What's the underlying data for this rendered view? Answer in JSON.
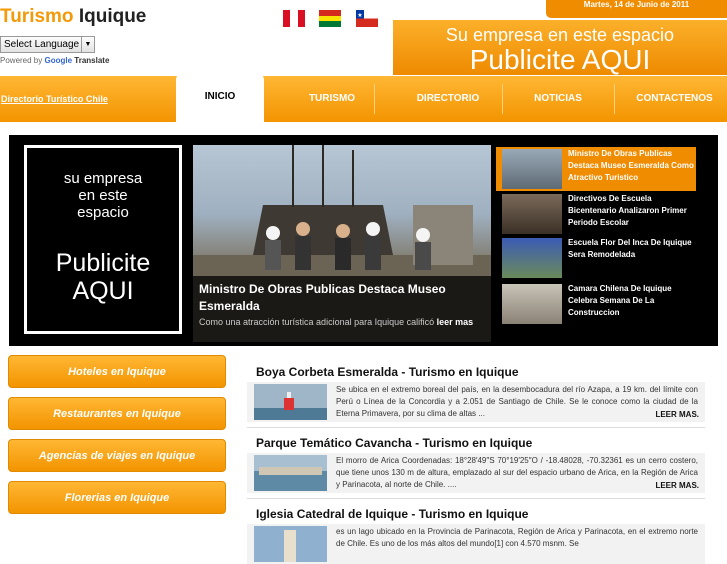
{
  "header": {
    "logo_part1": "Turismo",
    "logo_part2": "Iquique",
    "date": "Martes, 14 de Junio de 2011",
    "translate_select": "Select Language",
    "powered_by": "Powered by",
    "google": "Google",
    "translate": "Translate",
    "banner_line1": "Su empresa en este espacio",
    "banner_line2": "Publicite AQUI"
  },
  "nav": {
    "directory_link": "Directorio Turístico Chile",
    "items": [
      "INICIO",
      "TURISMO",
      "DIRECTORIO",
      "NOTICIAS",
      "CONTACTENOS"
    ]
  },
  "ad": {
    "line1": "su empresa",
    "line2": "en este",
    "line3": "espacio",
    "big1": "Publicite",
    "big2": "AQUI"
  },
  "feature": {
    "title": "Ministro De Obras Publicas Destaca Museo Esmeralda",
    "teaser": "Como una atracción turística adicional para Iquique calificó",
    "more": "leer mas"
  },
  "news": [
    "Ministro De Obras Publicas Destaca Museo Esmeralda Como Atractivo Turistico",
    "Directivos De Escuela Bicentenario Analizaron Primer Periodo Escolar",
    "Escuela Flor Del Inca De Iquique Sera Remodelada",
    "Camara Chilena De Iquique Celebra Semana De La Construccion"
  ],
  "sidebar": [
    "Hoteles en Iquique",
    "Restaurantes en Iquique",
    "Agencias de viajes en Iquique",
    "Florerias en Iquique"
  ],
  "articles": [
    {
      "title": "Boya Corbeta Esmeralda - Turismo en Iquique",
      "desc": "Se ubica en el extremo boreal del país, en la desembocadura del río Azapa, a 19 km. del límite con Perú o Línea de la Concordia y a 2.051 de Santiago de Chile. Se le conoce como la ciudad de la Eterna Primavera, por su clima de altas ...",
      "more": "LEER MAS."
    },
    {
      "title": "Parque Temático Cavancha - Turismo en Iquique",
      "desc": "El morro de Arica Coordenadas: 18°28′49″S 70°19′25″O / -18.48028, -70.32361 es un cerro costero, que tiene unos 130 m de altura, emplazado al sur del espacio urbano de Arica, en la Región de Arica y Parinacota, al norte de Chile. ....",
      "more": "LEER MAS."
    },
    {
      "title": "Iglesia Catedral de Iquique - Turismo en Iquique",
      "desc": "es un lago ubicado en la Provincia de Parinacota, Región de Arica y Parinacota, en el extremo norte de Chile. Es uno de los más altos del mundo[1] con 4.570 msnm. Se",
      "more": ""
    }
  ]
}
